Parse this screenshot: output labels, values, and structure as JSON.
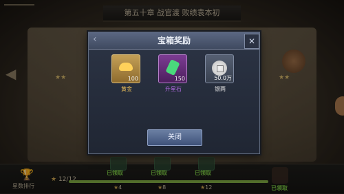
{
  "scene": {
    "chapter_banner": "第五十章 战官渡 败绩袁本初",
    "bottom": {
      "ranking_label": "星数排行",
      "star_progress": "12/12",
      "claimed_label": "已领取",
      "milestones": [
        "4",
        "8",
        "12"
      ],
      "progress_fraction": 1.0
    }
  },
  "dialog": {
    "title": "宝箱奖励",
    "close_button_label": "关闭",
    "rewards": [
      {
        "label": "黄金",
        "quantity": "100",
        "icon": "gold-ingot-icon",
        "label_color": "#f0c25a"
      },
      {
        "label": "升星石",
        "quantity": "150",
        "icon": "green-gem-icon",
        "label_color": "#b46ae6"
      },
      {
        "label": "银两",
        "quantity": "50.0万",
        "icon": "silver-coin-icon",
        "label_color": "#e6e6e6"
      }
    ]
  },
  "colors": {
    "claimed_green": "#78c243",
    "dialog_header": "#4f5b75",
    "button_blue": "#4d638e"
  }
}
